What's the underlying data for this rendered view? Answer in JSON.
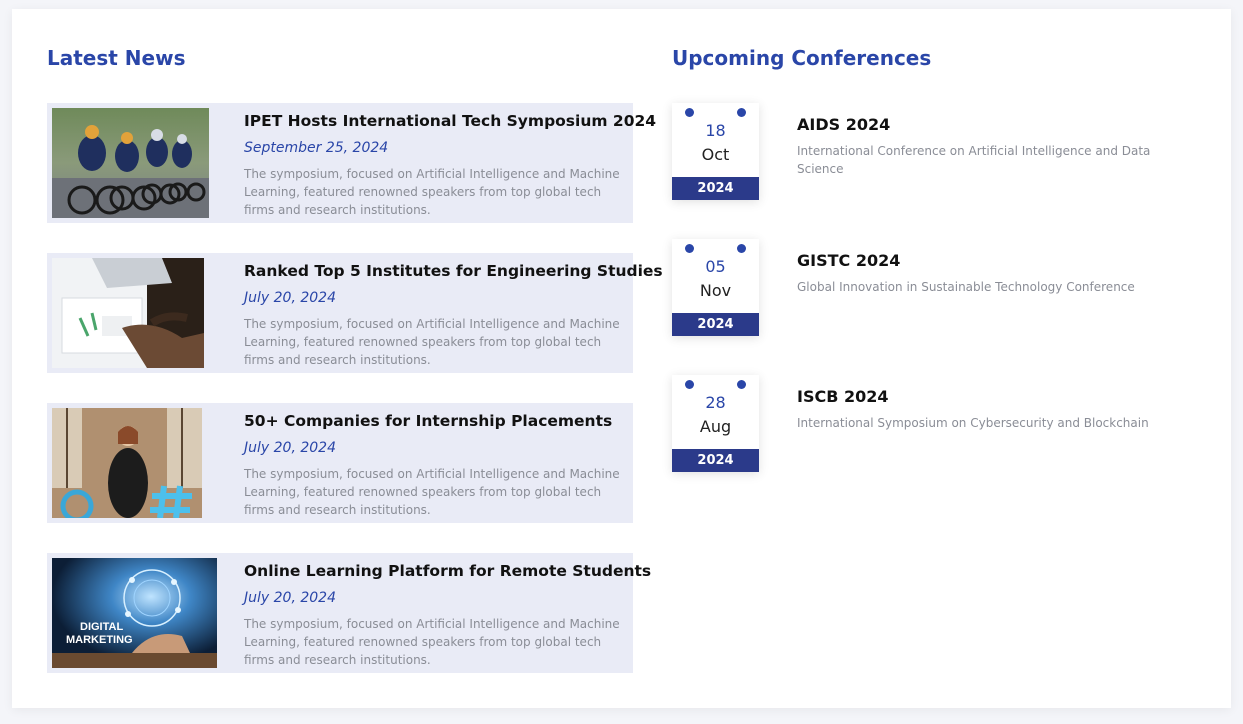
{
  "news": {
    "title": "Latest News",
    "items": [
      {
        "headline": "IPET Hosts International Tech Symposium 2024",
        "date": "September 25, 2024",
        "description": "The symposium, focused on Artificial Intelligence and Machine Learning, featured renowned speakers from top global tech firms and research institutions.",
        "image": "cycling-race-photo"
      },
      {
        "headline": "Ranked Top 5 Institutes for Engineering Studies",
        "date": "July 20, 2024",
        "description": "The symposium, focused on Artificial Intelligence and Machine Learning, featured renowned speakers from top global tech firms and research institutions.",
        "image": "desk-charts-photo"
      },
      {
        "headline": "50+ Companies for Internship Placements",
        "date": "July 20, 2024",
        "description": "The symposium, focused on Artificial Intelligence and Machine Learning, featured renowned speakers from top global tech firms and research institutions.",
        "image": "office-woman-photo"
      },
      {
        "headline": "Online Learning Platform for Remote Students",
        "date": "July 20, 2024",
        "description": "The symposium, focused on Artificial Intelligence and Machine Learning, featured renowned speakers from top global tech firms and research institutions.",
        "image": "digital-marketing-photo",
        "image_caption": "DIGITAL MARKETING"
      }
    ]
  },
  "conferences": {
    "title": "Upcoming Conferences",
    "items": [
      {
        "day": "18",
        "month": "Oct",
        "year": "2024",
        "name": "AIDS 2024",
        "description": "International Conference on Artificial Intelligence and Data Science"
      },
      {
        "day": "05",
        "month": "Nov",
        "year": "2024",
        "name": "GISTC 2024",
        "description": "Global Innovation in Sustainable Technology Conference"
      },
      {
        "day": "28",
        "month": "Aug",
        "year": "2024",
        "name": "ISCB 2024",
        "description": "International Symposium on Cybersecurity and Blockchain"
      }
    ]
  },
  "colors": {
    "accent": "#2a46a8",
    "year_band": "#2b3a8a",
    "news_bg": "#e9ebf6"
  }
}
